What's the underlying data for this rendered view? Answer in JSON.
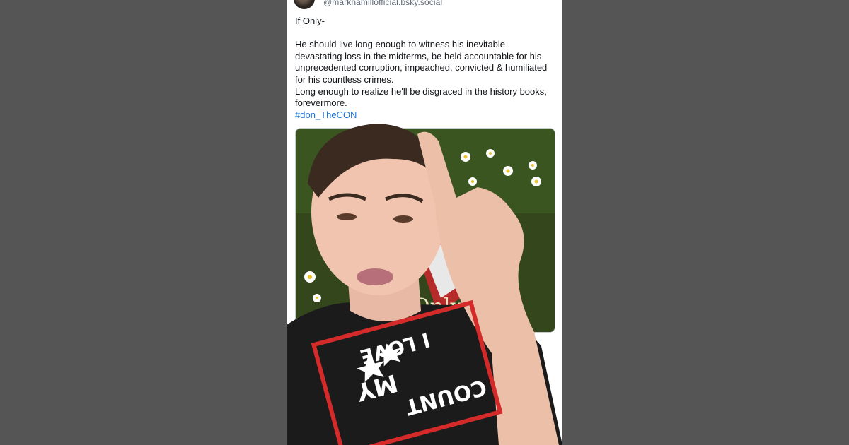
{
  "post": {
    "handle": "@markhamillofficial.bsky.social",
    "title_line": "If Only-",
    "paragraph": "He should live long enough to witness his inevitable devastating loss in the midterms, be held accountable for his unprecedented corruption, impeached, convicted & humiliated for his countless crimes.",
    "paragraph2": "Long enough to realize he'll be disgraced in the history books, forevermore.",
    "hashtag": "#don_TheCON"
  },
  "embed": {
    "poster_text": "Only"
  },
  "overlay": {
    "shirt_text_line1": "I LOVE",
    "shirt_text_line2": "MY",
    "shirt_text_line3": "COUNT"
  },
  "colors": {
    "background": "#555555",
    "card": "#ffffff",
    "link": "#1d74d6",
    "shirt": "#1b1b1b",
    "shirt_accent": "#d42a2a"
  }
}
